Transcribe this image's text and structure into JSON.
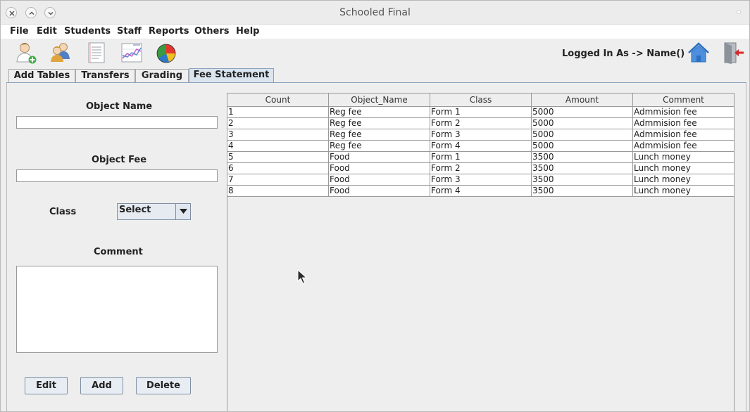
{
  "window": {
    "title": "Schooled Final",
    "buttons": [
      "close-icon",
      "maximize-icon",
      "minimize-icon"
    ]
  },
  "menubar": {
    "items": [
      "File",
      "Edit",
      "Students",
      "Staff",
      "Reports",
      "Others",
      "Help"
    ]
  },
  "toolbar": {
    "icons": [
      "add-student-icon",
      "users-icon",
      "notes-icon",
      "line-chart-icon",
      "pie-chart-icon"
    ],
    "logged_in_label": "Logged In As -> Name()",
    "right_icons": [
      "home-icon",
      "logout-icon"
    ]
  },
  "tabs": {
    "items": [
      "Add Tables",
      "Transfers",
      "Grading",
      "Fee Statement"
    ],
    "active": "Fee Statement"
  },
  "form": {
    "object_name_label": "Object Name",
    "object_name_value": "",
    "object_fee_label": "Object Fee",
    "object_fee_value": "",
    "class_label": "Class",
    "class_selected": "Select",
    "comment_label": "Comment",
    "comment_value": "",
    "edit_button": "Edit",
    "add_button": "Add",
    "delete_button": "Delete"
  },
  "table": {
    "columns": [
      "Count",
      "Object_Name",
      "Class",
      "Amount",
      "Comment"
    ],
    "rows": [
      [
        "1",
        "Reg fee",
        "Form 1",
        "5000",
        "Admmision fee"
      ],
      [
        "2",
        "Reg fee",
        "Form 2",
        "5000",
        "Admmision fee"
      ],
      [
        "3",
        "Reg fee",
        "Form 3",
        "5000",
        "Admmision fee"
      ],
      [
        "4",
        "Reg fee",
        "Form 4",
        "5000",
        "Admmision fee"
      ],
      [
        "5",
        "Food",
        "Form 1",
        "3500",
        "Lunch money"
      ],
      [
        "6",
        "Food",
        "Form 2",
        "3500",
        "Lunch money"
      ],
      [
        "7",
        "Food",
        "Form 3",
        "3500",
        "Lunch money"
      ],
      [
        "8",
        "Food",
        "Form 4",
        "3500",
        "Lunch money"
      ]
    ]
  },
  "colors": {
    "window_bg": "#eeeeee",
    "active_tab": "#dbe5f0",
    "button_bg": "#e8edf3",
    "grid_line": "#9a9a9a"
  }
}
